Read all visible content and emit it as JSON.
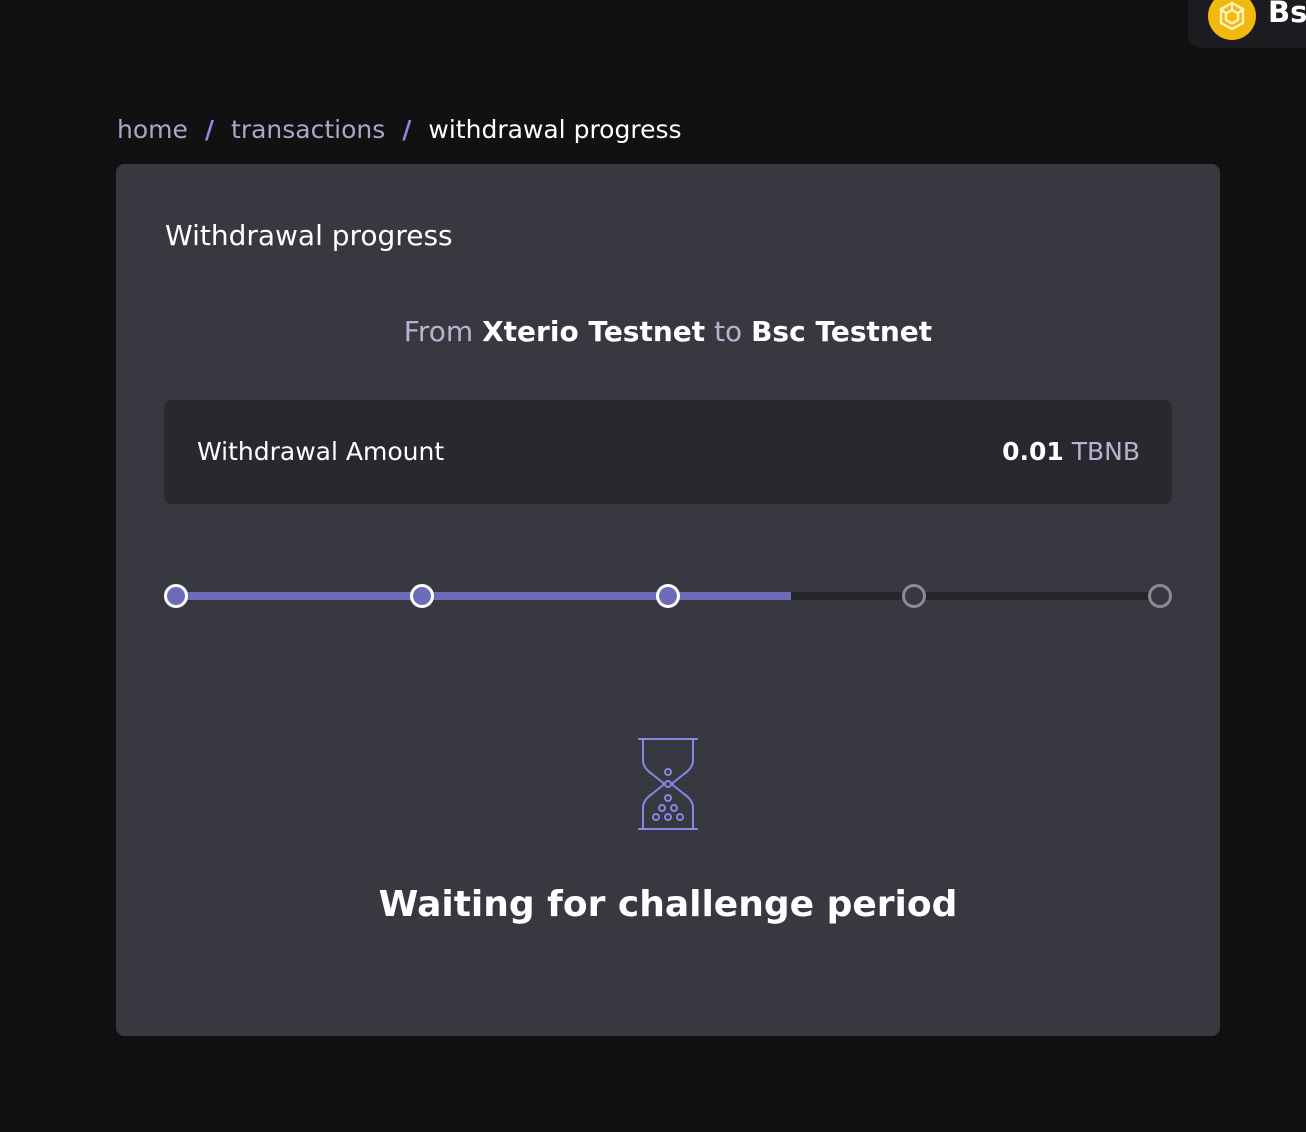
{
  "network": {
    "label": "Bs",
    "icon": "bnb-coin-icon",
    "color": "#f0b90b"
  },
  "breadcrumb": {
    "items": [
      "home",
      "transactions"
    ],
    "separator": "/",
    "current": "withdrawal progress"
  },
  "card": {
    "title": "Withdrawal progress",
    "route": {
      "from_prefix": "From",
      "from_network": "Xterio Testnet",
      "connector": "to",
      "to_network": "Bsc Testnet"
    },
    "amount": {
      "label": "Withdrawal Amount",
      "value": "0.01",
      "unit": "TBNB"
    },
    "progress": {
      "total_steps": 5,
      "completed_steps": 3,
      "fill_fraction": 0.625,
      "colors": {
        "fill": "#6c6cb8",
        "track": "#26262c",
        "pending_ring": "#8b8b95"
      }
    },
    "status": {
      "icon": "hourglass-icon",
      "text": "Waiting for challenge period"
    }
  },
  "colors": {
    "background": "#111112",
    "card": "#383841",
    "accent": "#8f86e8"
  }
}
